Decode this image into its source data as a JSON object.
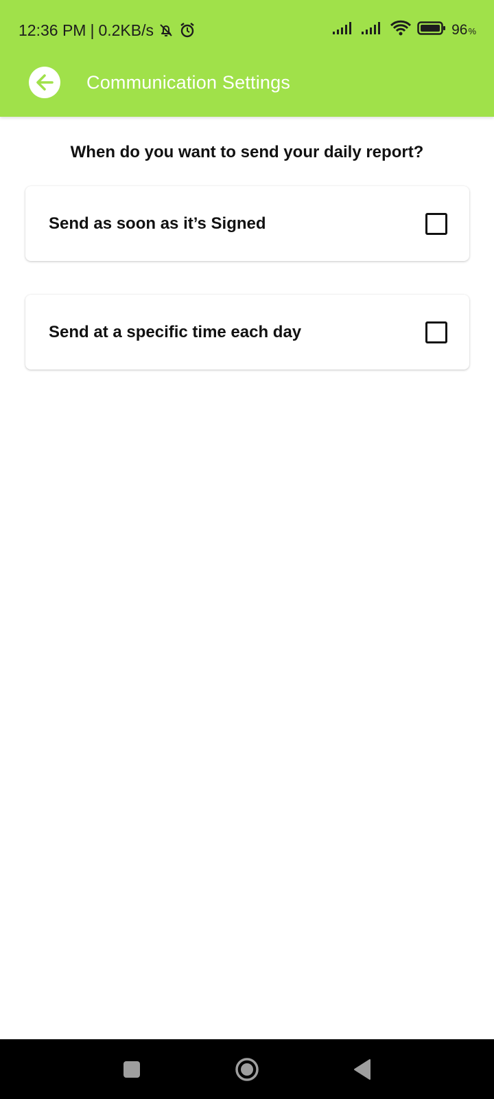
{
  "status_bar": {
    "time": "12:36 PM",
    "separator": "|",
    "network_speed": "0.2KB/s",
    "battery_level": "96",
    "battery_unit": "%",
    "icons": [
      "bell-off-icon",
      "alarm-icon",
      "signal-icon",
      "signal-icon",
      "wifi-icon",
      "battery-icon"
    ]
  },
  "app_bar": {
    "title": "Communication Settings",
    "back_icon": "arrow-left-icon"
  },
  "main": {
    "question": "When do you want to send your daily report?",
    "options": [
      {
        "label": "Send as soon as it’s Signed",
        "checked": false
      },
      {
        "label": "Send at a specific time each day",
        "checked": false
      }
    ]
  },
  "nav_bar": {
    "icons": [
      "recent-apps-icon",
      "home-icon",
      "back-icon"
    ]
  },
  "colors": {
    "accent": "#a0e14a",
    "background": "#ffffff",
    "text": "#111111",
    "navbar": "#000000"
  }
}
